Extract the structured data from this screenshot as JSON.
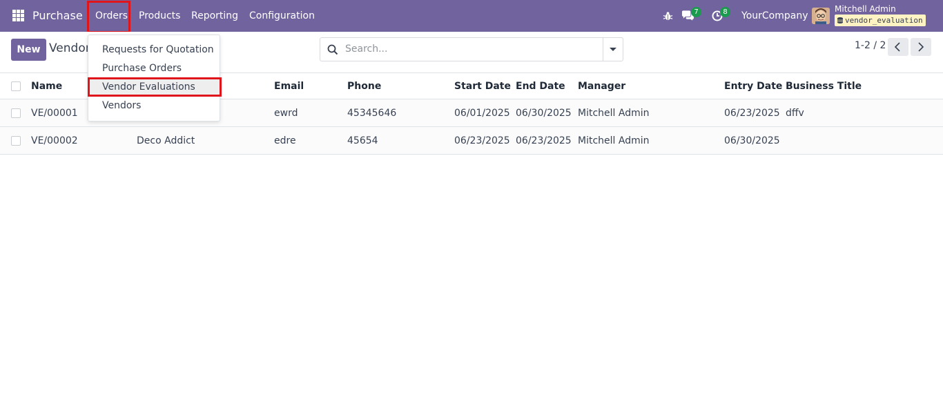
{
  "navbar": {
    "app_title": "Purchase",
    "menu": [
      "Orders",
      "Products",
      "Reporting",
      "Configuration"
    ],
    "chat_count": "7",
    "activity_count": "8",
    "company": "YourCompany",
    "user_name": "Mitchell Admin",
    "database": "vendor_evaluation"
  },
  "control": {
    "new_label": "New",
    "breadcrumb": "Vendor",
    "search_placeholder": "Search...",
    "pager": "1-2 / 2"
  },
  "dropdown": {
    "items": [
      "Requests for Quotation",
      "Purchase Orders",
      "Vendor Evaluations",
      "Vendors"
    ],
    "active_item": "Vendor Evaluations"
  },
  "table": {
    "columns": [
      "Name",
      "",
      "Email",
      "Phone",
      "Start Date",
      "End Date",
      "Manager",
      "Entry Date",
      "Business Title"
    ],
    "rows": [
      {
        "name": "VE/00001",
        "vendor": "",
        "email": "ewrd",
        "phone": "45345646",
        "start_date": "06/01/2025",
        "end_date": "06/30/2025",
        "manager": "Mitchell Admin",
        "entry_date": "06/23/2025",
        "business_title": "dffv"
      },
      {
        "name": "VE/00002",
        "vendor": "Deco Addict",
        "email": "edre",
        "phone": "45654",
        "start_date": "06/23/2025",
        "end_date": "06/23/2025",
        "manager": "Mitchell Admin",
        "entry_date": "06/30/2025",
        "business_title": ""
      }
    ]
  },
  "colors": {
    "brand": "#71639e",
    "highlight": "#e0141b",
    "badge": "#1b9b4d"
  }
}
